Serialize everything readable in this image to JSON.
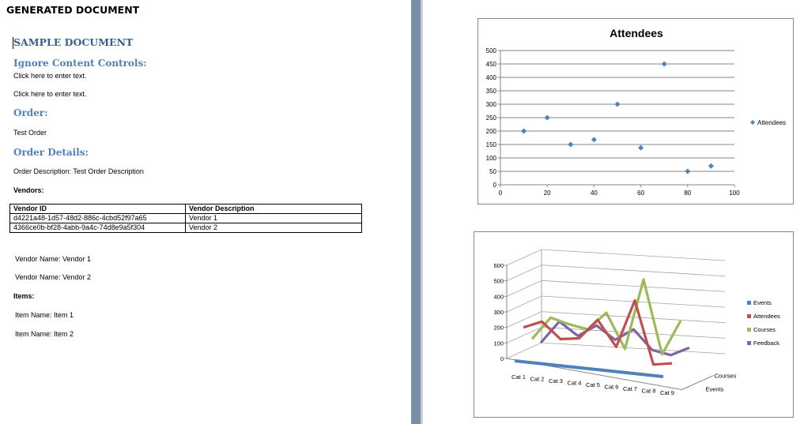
{
  "document": {
    "title": "GENERATED DOCUMENT",
    "sample_heading": "SAMPLE DOCUMENT",
    "ignore_heading": "Ignore Content Controls:",
    "placeholder_1": "Click here to enter text.",
    "placeholder_2": "Click here to enter text.",
    "order_heading": "Order:",
    "order_value": "Test Order",
    "order_details_heading": "Order Details:",
    "order_description": "Order Description: Test Order Description",
    "vendors_label": "Vendors:",
    "vendors_table": {
      "headers": [
        "Vendor ID",
        "Vendor Description"
      ],
      "rows": [
        [
          "d4221a48-1d57-48d2-886c-4cbd52f97a65",
          "Vendor 1"
        ],
        [
          "4366ce0b-bf28-4abb-9a4c-74d8e9a5f304",
          "Vendor 2"
        ]
      ]
    },
    "vendor_name_1": "Vendor Name: Vendor 1",
    "vendor_name_2": "Vendor Name: Vendor 2",
    "items_label": "Items:",
    "item_name_1": "Item Name: Item 1",
    "item_name_2": "Item Name: Item 2"
  },
  "chart_data": [
    {
      "type": "scatter",
      "title": "Attendees",
      "xlabel": "",
      "ylabel": "",
      "xlim": [
        0,
        100
      ],
      "ylim": [
        0,
        500
      ],
      "xticks": [
        0,
        20,
        40,
        60,
        80,
        100
      ],
      "yticks": [
        0,
        50,
        100,
        150,
        200,
        250,
        300,
        350,
        400,
        450,
        500
      ],
      "grid": true,
      "legend": "right",
      "series": [
        {
          "name": "Attendees",
          "color": "#4f81bd",
          "x": [
            10,
            20,
            30,
            40,
            50,
            60,
            70,
            80,
            90
          ],
          "y": [
            200,
            250,
            150,
            168,
            300,
            138,
            450,
            50,
            70
          ]
        }
      ]
    },
    {
      "type": "line",
      "subtype": "3d-line",
      "title": "",
      "xlabel": "",
      "ylabel": "",
      "ylim": [
        0,
        600
      ],
      "yticks": [
        0,
        100,
        200,
        300,
        400,
        500,
        600
      ],
      "grid": true,
      "legend": "right",
      "categories": [
        "Cat 1",
        "Cat 2",
        "Cat 3",
        "Cat 4",
        "Cat 5",
        "Cat 6",
        "Cat 7",
        "Cat 8",
        "Cat 9"
      ],
      "depth_labels": [
        "Events",
        "Courses"
      ],
      "series": [
        {
          "name": "Events",
          "color": "#4f81bd",
          "values": [
            10,
            10,
            10,
            10,
            10,
            10,
            10,
            10,
            10
          ]
        },
        {
          "name": "Attendees",
          "color": "#c0504d",
          "values": [
            200,
            250,
            150,
            168,
            300,
            138,
            450,
            50,
            70
          ]
        },
        {
          "name": "Courses",
          "color": "#9bbb59",
          "values": [
            100,
            250,
            220,
            200,
            320,
            100,
            560,
            90,
            320
          ]
        },
        {
          "name": "Feedback",
          "color": "#8064a2",
          "values": [
            50,
            200,
            120,
            200,
            120,
            200,
            80,
            60,
            120
          ]
        }
      ]
    }
  ]
}
